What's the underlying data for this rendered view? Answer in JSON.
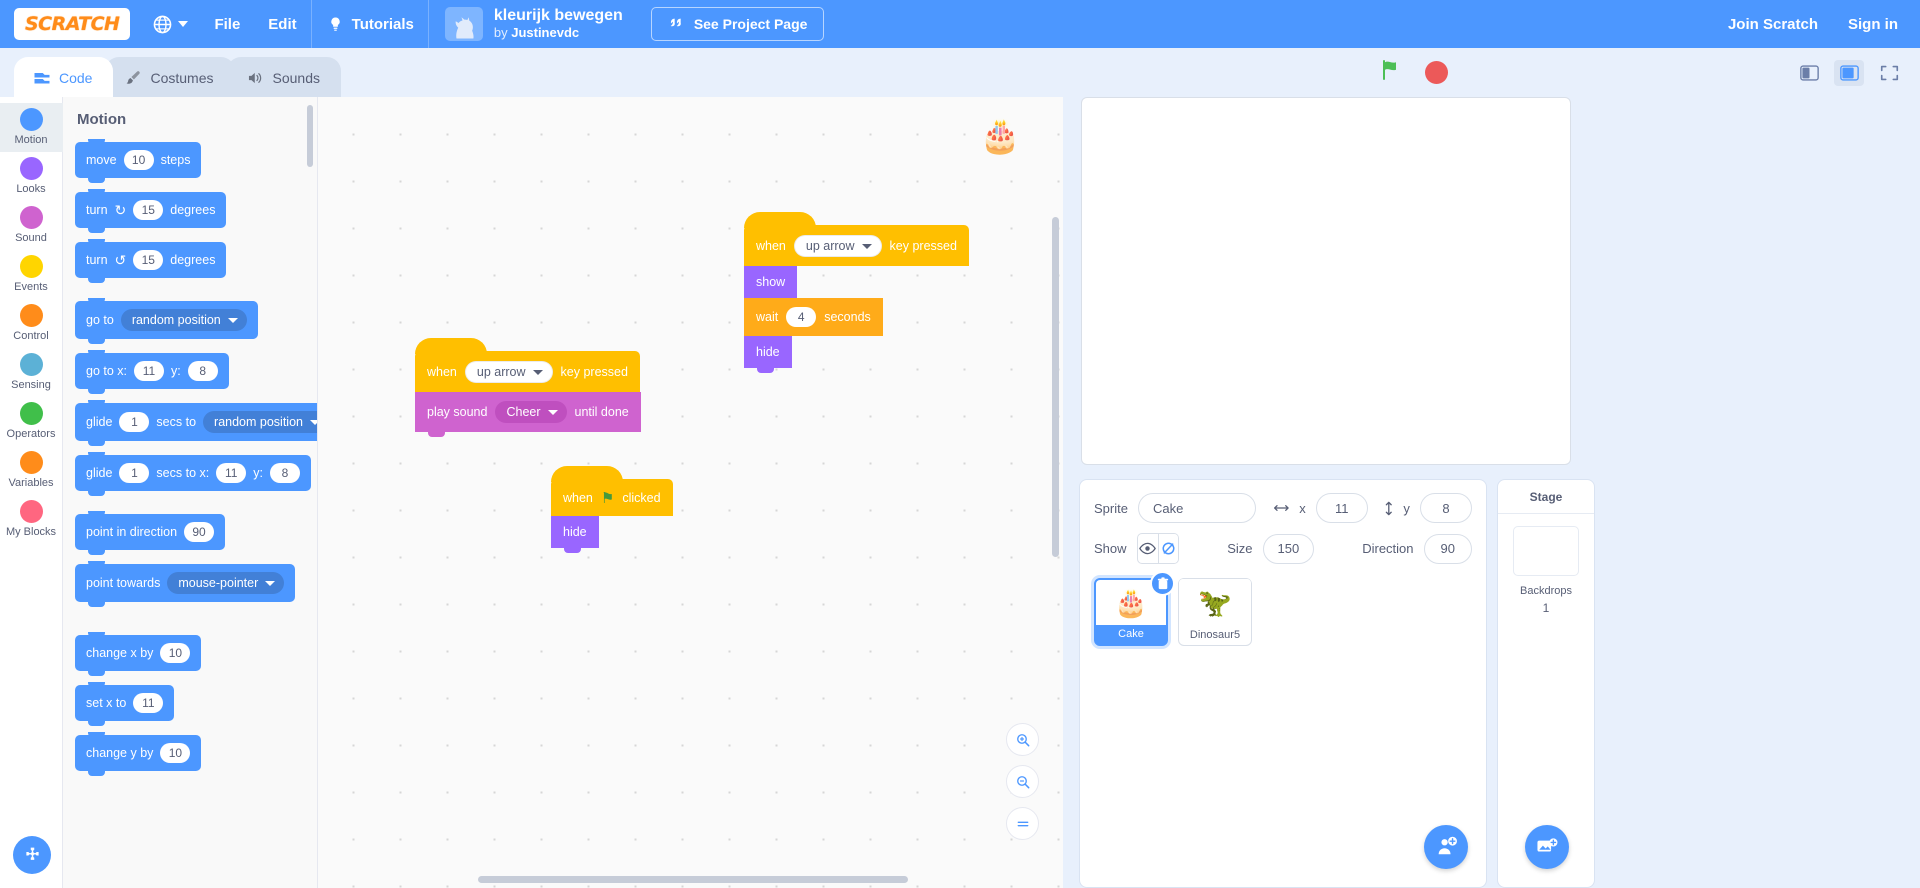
{
  "menubar": {
    "logo_text": "SCRATCH",
    "globe_icon": "globe-icon",
    "items": [
      "File",
      "Edit"
    ],
    "tutorials": "Tutorials",
    "project_title": "kleurijk bewegen",
    "project_by_prefix": "by ",
    "project_author": "Justinevdc",
    "see_project_page": "See Project Page",
    "join": "Join Scratch",
    "signin": "Sign in",
    "accent": "#4c97ff"
  },
  "tabs": [
    {
      "label": "Code",
      "icon": "code-icon",
      "active": true
    },
    {
      "label": "Costumes",
      "icon": "brush-icon",
      "active": false
    },
    {
      "label": "Sounds",
      "icon": "speaker-icon",
      "active": false
    }
  ],
  "categories": [
    {
      "label": "Motion",
      "color": "#4c97ff",
      "active": true
    },
    {
      "label": "Looks",
      "color": "#9966ff",
      "active": false
    },
    {
      "label": "Sound",
      "color": "#cf63cf",
      "active": false
    },
    {
      "label": "Events",
      "color": "#ffd500",
      "active": false
    },
    {
      "label": "Control",
      "color": "#ff8c1a",
      "active": false
    },
    {
      "label": "Sensing",
      "color": "#5cb1d6",
      "active": false
    },
    {
      "label": "Operators",
      "color": "#40bf4a",
      "active": false
    },
    {
      "label": "Variables",
      "color": "#ff8c1a",
      "active": false
    },
    {
      "label": "My Blocks",
      "color": "#ff6680",
      "active": false
    }
  ],
  "palette": {
    "header": "Motion",
    "blocks": [
      {
        "id": "move",
        "parts": [
          {
            "t": "text",
            "v": "move"
          },
          {
            "t": "oval",
            "v": "10"
          },
          {
            "t": "text",
            "v": "steps"
          }
        ]
      },
      {
        "id": "turn-right",
        "parts": [
          {
            "t": "text",
            "v": "turn"
          },
          {
            "t": "icon",
            "v": "↻"
          },
          {
            "t": "oval",
            "v": "15"
          },
          {
            "t": "text",
            "v": "degrees"
          }
        ]
      },
      {
        "id": "turn-left",
        "parts": [
          {
            "t": "text",
            "v": "turn"
          },
          {
            "t": "icon",
            "v": "↺"
          },
          {
            "t": "oval",
            "v": "15"
          },
          {
            "t": "text",
            "v": "degrees"
          }
        ]
      },
      {
        "id": "go-to",
        "parts": [
          {
            "t": "text",
            "v": "go to"
          },
          {
            "t": "drop",
            "v": "random position"
          }
        ]
      },
      {
        "id": "go-to-xy",
        "parts": [
          {
            "t": "text",
            "v": "go to x:"
          },
          {
            "t": "oval",
            "v": "11"
          },
          {
            "t": "text",
            "v": "y:"
          },
          {
            "t": "oval",
            "v": "8"
          }
        ]
      },
      {
        "id": "glide-rand",
        "parts": [
          {
            "t": "text",
            "v": "glide"
          },
          {
            "t": "oval",
            "v": "1"
          },
          {
            "t": "text",
            "v": "secs to"
          },
          {
            "t": "drop",
            "v": "random position"
          }
        ]
      },
      {
        "id": "glide-xy",
        "parts": [
          {
            "t": "text",
            "v": "glide"
          },
          {
            "t": "oval",
            "v": "1"
          },
          {
            "t": "text",
            "v": "secs to x:"
          },
          {
            "t": "oval",
            "v": "11"
          },
          {
            "t": "text",
            "v": "y:"
          },
          {
            "t": "oval",
            "v": "8"
          }
        ]
      },
      {
        "id": "point-dir",
        "parts": [
          {
            "t": "text",
            "v": "point in direction"
          },
          {
            "t": "oval",
            "v": "90"
          }
        ]
      },
      {
        "id": "point-to",
        "parts": [
          {
            "t": "text",
            "v": "point towards"
          },
          {
            "t": "drop",
            "v": "mouse-pointer"
          }
        ]
      },
      {
        "id": "change-x",
        "parts": [
          {
            "t": "text",
            "v": "change x by"
          },
          {
            "t": "oval",
            "v": "10"
          }
        ]
      },
      {
        "id": "set-x",
        "parts": [
          {
            "t": "text",
            "v": "set x to"
          },
          {
            "t": "oval",
            "v": "11"
          }
        ]
      },
      {
        "id": "change-y",
        "parts": [
          {
            "t": "text",
            "v": "change y by"
          },
          {
            "t": "oval",
            "v": "10"
          }
        ]
      }
    ]
  },
  "scripts": [
    {
      "id": "script-key-show-hide",
      "hat": {
        "pre": "when",
        "dropdown": "up arrow",
        "post": "key pressed"
      },
      "blocks": [
        {
          "cls": "looks",
          "parts": [
            {
              "t": "text",
              "v": "show"
            }
          ]
        },
        {
          "cls": "control",
          "parts": [
            {
              "t": "text",
              "v": "wait"
            },
            {
              "t": "oval",
              "v": "4"
            },
            {
              "t": "text",
              "v": "seconds"
            }
          ]
        },
        {
          "cls": "looks",
          "parts": [
            {
              "t": "text",
              "v": "hide"
            }
          ]
        }
      ]
    },
    {
      "id": "script-key-play-sound",
      "hat": {
        "pre": "when",
        "dropdown": "up arrow",
        "post": "key pressed"
      },
      "blocks": [
        {
          "cls": "sound",
          "parts": [
            {
              "t": "text",
              "v": "play sound"
            },
            {
              "t": "sdrop",
              "v": "Cheer"
            },
            {
              "t": "text",
              "v": "until done"
            }
          ]
        }
      ]
    },
    {
      "id": "script-flag-hide",
      "hat": {
        "pre": "when",
        "flag": "green-flag-icon",
        "post": "clicked"
      },
      "blocks": [
        {
          "cls": "looks",
          "parts": [
            {
              "t": "text",
              "v": "hide"
            }
          ]
        }
      ]
    }
  ],
  "stage_controls": {
    "green_flag": "green-flag-icon",
    "stop": "stop-icon",
    "small_stage": "small-stage-icon",
    "large_stage": "large-stage-icon",
    "fullscreen": "fullscreen-icon"
  },
  "sprite_info": {
    "sprite_label": "Sprite",
    "sprite_name": "Cake",
    "x_label": "x",
    "x_value": "11",
    "y_label": "y",
    "y_value": "8",
    "show_label": "Show",
    "show_visible": false,
    "size_label": "Size",
    "size_value": "150",
    "direction_label": "Direction",
    "direction_value": "90"
  },
  "sprites": [
    {
      "name": "Cake",
      "icon": "🎂",
      "selected": true
    },
    {
      "name": "Dinosaur5",
      "icon": "🦖",
      "selected": false
    }
  ],
  "stage_panel": {
    "title": "Stage",
    "backdrops_label": "Backdrops",
    "backdrops_count": "1"
  },
  "zoom_controls": {
    "zoom_in": "+",
    "zoom_out": "−",
    "zoom_reset": "="
  }
}
